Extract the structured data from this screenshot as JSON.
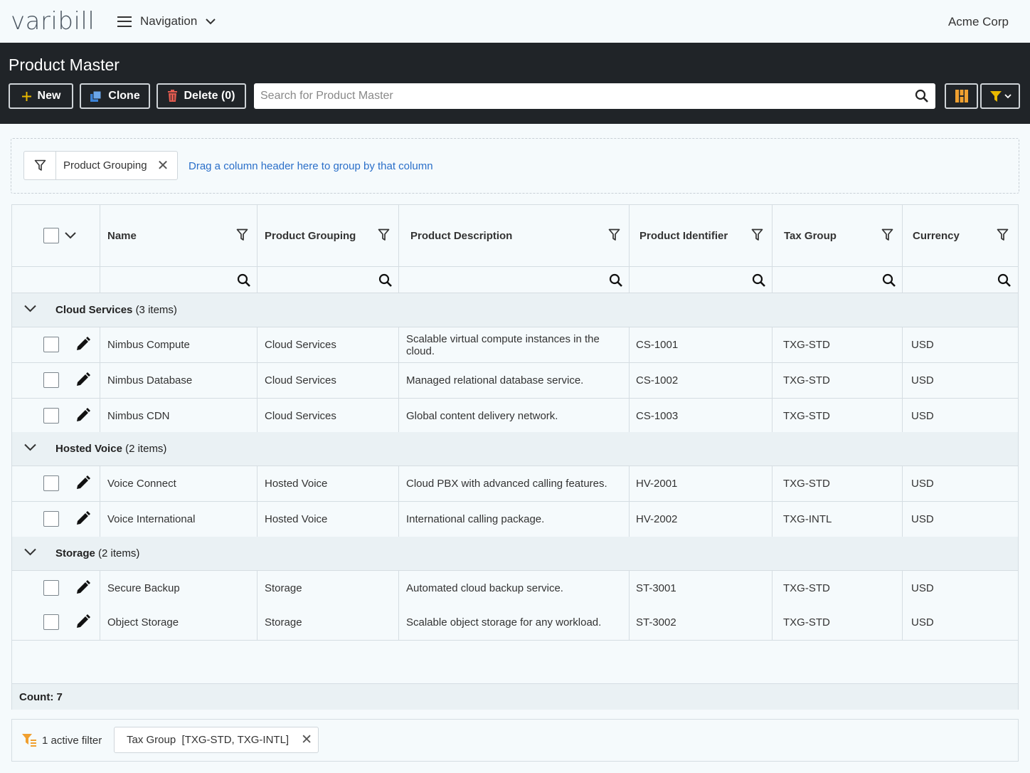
{
  "app": {
    "logo_text": "varibill",
    "nav_label": "Navigation",
    "company": "Acme Corp",
    "brand_colors": [
      "#e74c3c",
      "#27ae60",
      "#f1c40f",
      "#3498db"
    ]
  },
  "header": {
    "title": "Product Master",
    "new_label": "New",
    "clone_label": "Clone",
    "delete_label": "Delete (0)",
    "search_placeholder": "Search for Product Master",
    "search_value": ""
  },
  "group_panel": {
    "chip_label": "Product Grouping",
    "hint": "Drag a column header here to group by that column"
  },
  "columns": [
    "Name",
    "Product Grouping",
    "Product Description",
    "Product Identifier",
    "Tax Group",
    "Currency"
  ],
  "groups": [
    {
      "name": "Cloud Services",
      "count_text": "(3 items)",
      "rows": [
        {
          "name": "Nimbus Compute",
          "grouping": "Cloud Services",
          "description": "Scalable virtual compute instances in the cloud.",
          "identifier": "CS-1001",
          "tax_group": "TXG-STD",
          "currency": "USD"
        },
        {
          "name": "Nimbus Database",
          "grouping": "Cloud Services",
          "description": "Managed relational database service.",
          "identifier": "CS-1002",
          "tax_group": "TXG-STD",
          "currency": "USD"
        },
        {
          "name": "Nimbus CDN",
          "grouping": "Cloud Services",
          "description": "Global content delivery network.",
          "identifier": "CS-1003",
          "tax_group": "TXG-STD",
          "currency": "USD"
        }
      ]
    },
    {
      "name": "Hosted Voice",
      "count_text": "(2 items)",
      "rows": [
        {
          "name": "Voice Connect",
          "grouping": "Hosted Voice",
          "description": "Cloud PBX with advanced calling features.",
          "identifier": "HV-2001",
          "tax_group": "TXG-STD",
          "currency": "USD"
        },
        {
          "name": "Voice International",
          "grouping": "Hosted Voice",
          "description": "International calling package.",
          "identifier": "HV-2002",
          "tax_group": "TXG-INTL",
          "currency": "USD"
        }
      ]
    },
    {
      "name": "Storage",
      "count_text": "(2 items)",
      "rows": [
        {
          "name": "Secure Backup",
          "grouping": "Storage",
          "description": "Automated cloud backup service.",
          "identifier": "ST-3001",
          "tax_group": "TXG-STD",
          "currency": "USD"
        },
        {
          "name": "Object Storage",
          "grouping": "Storage",
          "description": "Scalable object storage for any workload.",
          "identifier": "ST-3002",
          "tax_group": "TXG-STD",
          "currency": "USD"
        }
      ]
    }
  ],
  "footer": {
    "count": "Count: 7"
  },
  "active_filters": {
    "summary": "1 active filter",
    "chip_label": "Tax Group  [TXG-STD, TXG-INTL]"
  },
  "colors": {
    "header_bg": "#202428",
    "link": "#2a6fc9",
    "delete_icon": "#e05a4f",
    "clone_icon": "#3b82d6",
    "filter_icon": "#e8b800",
    "layout_icon": "#f0a030"
  }
}
